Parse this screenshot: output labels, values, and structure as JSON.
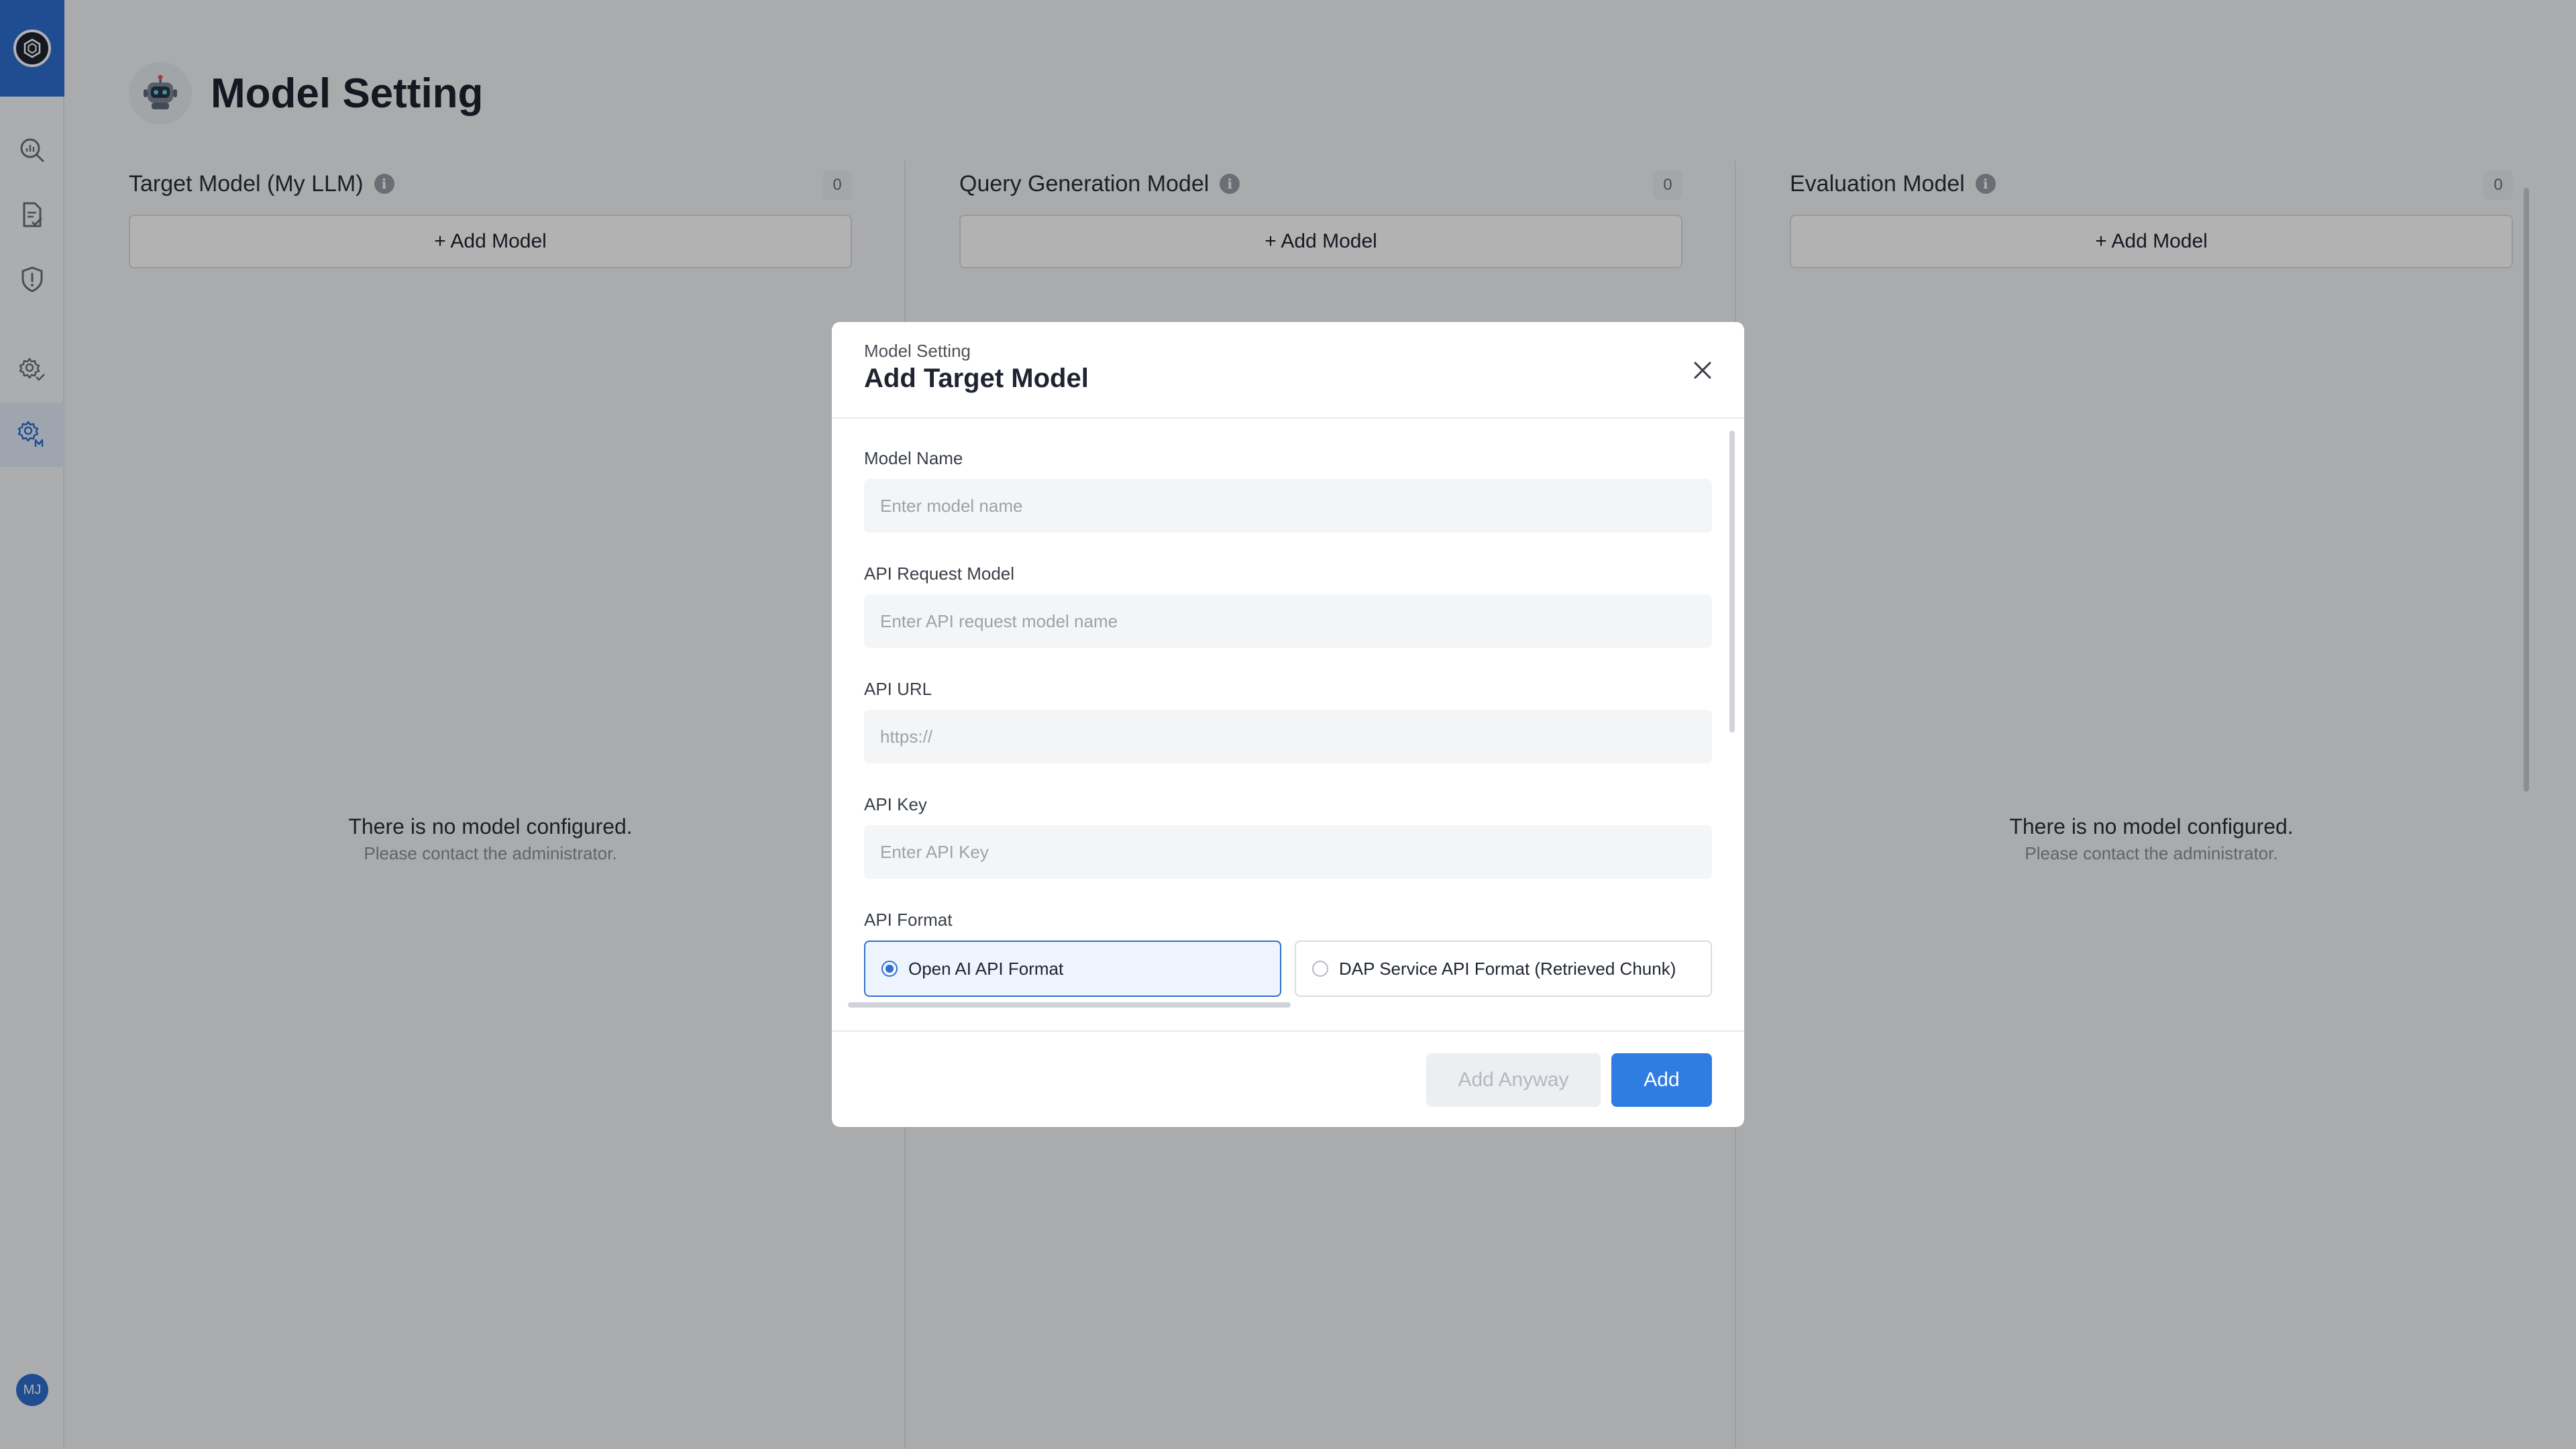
{
  "sidebar": {
    "avatar_initials": "MJ",
    "nav_icons": [
      "dashboard-icon",
      "report-icon",
      "security-icon",
      "settings-icon",
      "model-settings-icon"
    ],
    "accent_color": "#2f6fd0"
  },
  "page": {
    "title": "Model Setting"
  },
  "columns": [
    {
      "title": "Target Model (My LLM)",
      "count": "0",
      "add_label": "+ Add Model",
      "empty_title": "There is no model configured.",
      "empty_subtitle": "Please contact the administrator."
    },
    {
      "title": "Query Generation Model",
      "count": "0",
      "add_label": "+ Add Model"
    },
    {
      "title": "Evaluation Model",
      "count": "0",
      "add_label": "+ Add Model",
      "empty_title": "There is no model configured.",
      "empty_subtitle": "Please contact the administrator."
    }
  ],
  "modal": {
    "subtitle": "Model Setting",
    "title": "Add Target Model",
    "fields": {
      "model_name": {
        "label": "Model Name",
        "value": "",
        "placeholder": "Enter model name"
      },
      "api_request_model": {
        "label": "API Request Model",
        "value": "",
        "placeholder": "Enter API request model name"
      },
      "api_url": {
        "label": "API URL",
        "value": "",
        "placeholder": "https://"
      },
      "api_key": {
        "label": "API Key",
        "value": "",
        "placeholder": "Enter API Key"
      }
    },
    "api_format": {
      "label": "API Format",
      "selected": "Open AI API Format",
      "options": [
        "Open AI API Format",
        "DAP Service API Format (Retrieved Chunk)"
      ]
    },
    "buttons": {
      "add_anyway": "Add Anyway",
      "add": "Add"
    }
  }
}
